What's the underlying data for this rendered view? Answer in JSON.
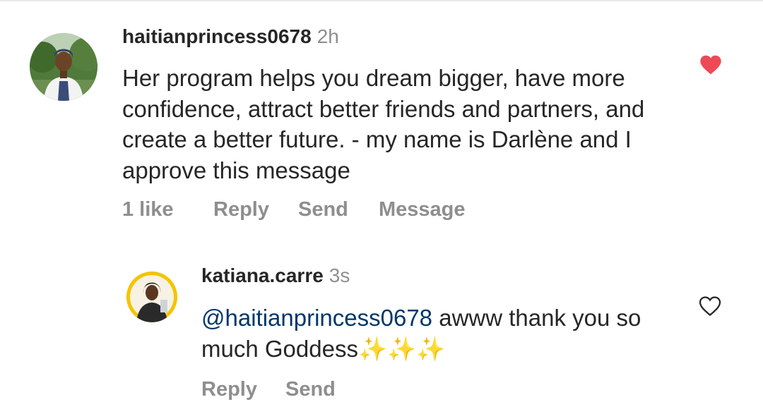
{
  "comments": [
    {
      "username": "haitianprincess0678",
      "time": "2h",
      "text": "Her program helps you dream bigger, have more confidence, attract better friends and partners, and create a better future. - my name is Darlène and I approve this message",
      "liked": true,
      "actions": {
        "likes": "1 like",
        "reply": "Reply",
        "send": "Send",
        "message": "Message"
      }
    },
    {
      "username": "katiana.carre",
      "time": "3s",
      "mention": "@haitianprincess0678",
      "text": " awww thank you so much Goddess",
      "emoji": "✨✨✨",
      "liked": false,
      "actions": {
        "reply": "Reply",
        "send": "Send"
      }
    }
  ],
  "colors": {
    "heart_filled": "#ed4956",
    "mention": "#00376b",
    "secondary": "#8e8e8e"
  }
}
